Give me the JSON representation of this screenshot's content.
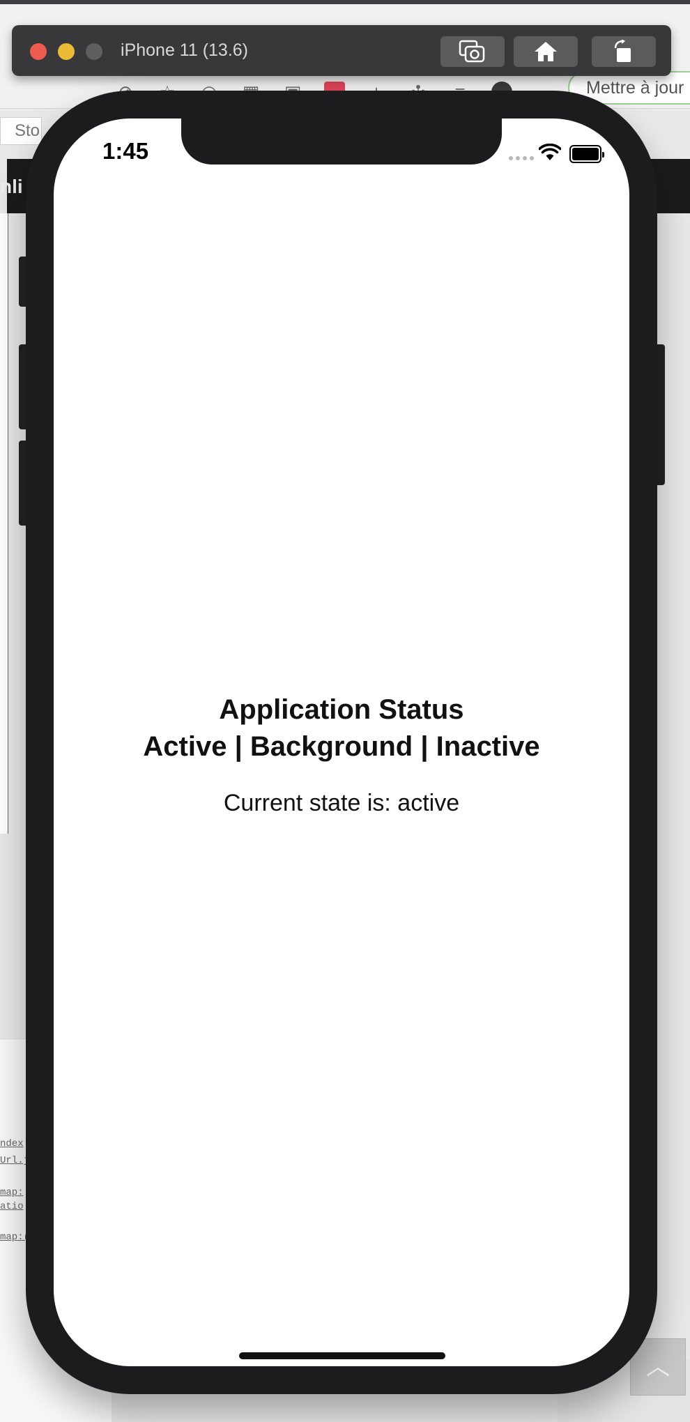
{
  "simulator": {
    "title": "iPhone 11 (13.6)",
    "buttons": {
      "screenshot": "camera-icon",
      "home": "home-icon",
      "rotate": "rotate-icon"
    }
  },
  "background_browser": {
    "update_button_label": "Mettre à jour",
    "tab_fragment": "Sto",
    "darkbar_fragment": "nli",
    "code_fragments": [
      "ndex",
      "Url.j",
      "map:",
      "atio",
      "map:("
    ]
  },
  "phone": {
    "status_bar": {
      "time": "1:45",
      "icons": [
        "signal-icon",
        "wifi-icon",
        "battery-icon"
      ]
    },
    "app": {
      "heading": "Application Status",
      "states_line": "Active | Background | Inactive",
      "current_state": "Current state is: active"
    }
  },
  "colors": {
    "close": "#ee5b51",
    "minimize": "#e9bb39",
    "zoom_inactive": "#5f5f62",
    "device_frame": "#1c1c1e"
  }
}
